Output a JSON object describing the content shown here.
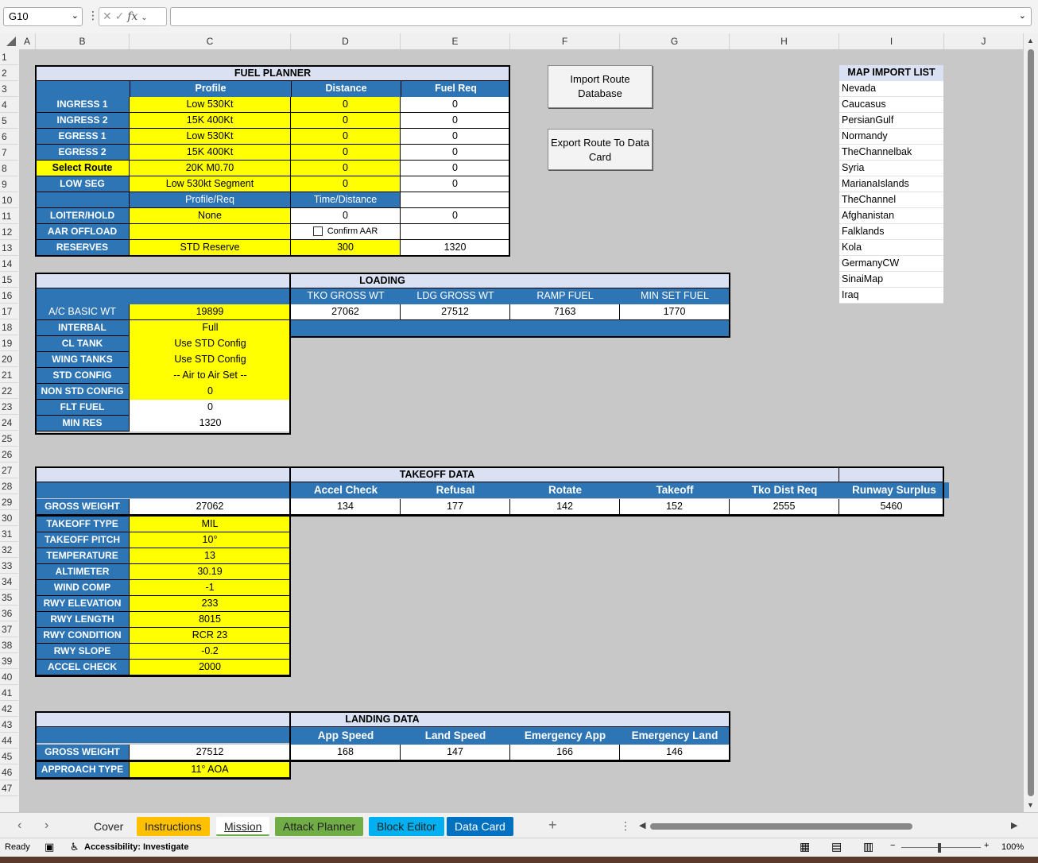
{
  "app": {
    "name_box": "G10",
    "fx_label": "fx",
    "status_ready": "Ready",
    "accessibility": "Accessibility: Investigate",
    "zoom": "100%"
  },
  "columns": [
    "A",
    "B",
    "C",
    "D",
    "E",
    "F",
    "G",
    "H",
    "I",
    "J"
  ],
  "rows": [
    "1",
    "2",
    "3",
    "4",
    "5",
    "6",
    "7",
    "8",
    "9",
    "10",
    "11",
    "12",
    "13",
    "14",
    "15",
    "16",
    "17",
    "18",
    "19",
    "20",
    "21",
    "22",
    "23",
    "24",
    "25",
    "26",
    "27",
    "28",
    "29",
    "30",
    "31",
    "32",
    "33",
    "34",
    "35",
    "36",
    "37",
    "38",
    "39",
    "40",
    "41",
    "42",
    "43",
    "44",
    "45",
    "46",
    "47"
  ],
  "fuel_planner": {
    "title": "FUEL PLANNER",
    "headers": [
      "Profile",
      "Distance",
      "Fuel Req"
    ],
    "rows": [
      {
        "label": "INGRESS 1",
        "profile": "Low 530Kt",
        "distance": "0",
        "fuel": "0"
      },
      {
        "label": "INGRESS 2",
        "profile": "15K 400Kt",
        "distance": "0",
        "fuel": "0"
      },
      {
        "label": "EGRESS 1",
        "profile": "Low 530Kt",
        "distance": "0",
        "fuel": "0"
      },
      {
        "label": "EGRESS 2",
        "profile": "15K 400Kt",
        "distance": "0",
        "fuel": "0"
      },
      {
        "label": "Select Route",
        "profile": "20K M0.70",
        "distance": "0",
        "fuel": "0"
      },
      {
        "label": "LOW SEG",
        "profile": "Low 530kt Segment",
        "distance": "0",
        "fuel": "0"
      }
    ],
    "sub_headers": [
      "Profile/Req",
      "Time/Distance"
    ],
    "loiter": {
      "label": "LOITER/HOLD",
      "profile": "None",
      "time": "0",
      "fuel": "0"
    },
    "aar": {
      "label": "AAR OFFLOAD",
      "confirm": "Confirm AAR"
    },
    "reserves": {
      "label": "RESERVES",
      "profile": "STD Reserve",
      "value": "300",
      "fuel": "1320"
    }
  },
  "buttons": {
    "import": "Import Route Database",
    "export": "Export Route To Data Card"
  },
  "map_import": {
    "title": "MAP IMPORT LIST",
    "items": [
      "Nevada",
      "Caucasus",
      "PersianGulf",
      "Normandy",
      "TheChannelbak",
      "Syria",
      "MarianaIslands",
      "TheChannel",
      "Afghanistan",
      "Falklands",
      "Kola",
      "GermanyCW",
      "SinaiMap",
      "Iraq"
    ]
  },
  "loading": {
    "title": "LOADING",
    "headers": [
      "TKO GROSS WT",
      "LDG GROSS WT",
      "RAMP FUEL",
      "MIN SET FUEL"
    ],
    "basic_label": "A/C BASIC WT",
    "basic_value": "19899",
    "values": [
      "27062",
      "27512",
      "7163",
      "1770"
    ],
    "rows": [
      {
        "label": "INTERBAL",
        "value": "Full",
        "yellow": true
      },
      {
        "label": "CL TANK",
        "value": "Use STD Config",
        "yellow": true
      },
      {
        "label": "WING TANKS",
        "value": "Use STD Config",
        "yellow": true
      },
      {
        "label": "STD CONFIG",
        "value": "-- Air to Air Set --",
        "yellow": true
      },
      {
        "label": "NON STD CONFIG",
        "value": "0",
        "yellow": true
      },
      {
        "label": "FLT FUEL",
        "value": "0",
        "yellow": false
      },
      {
        "label": "MIN RES",
        "value": "1320",
        "yellow": false
      }
    ]
  },
  "takeoff": {
    "title": "TAKEOFF DATA",
    "headers": [
      "Accel Check",
      "Refusal",
      "Rotate",
      "Takeoff",
      "Tko Dist Req",
      "Runway Surplus"
    ],
    "gross_label": "GROSS WEIGHT",
    "gross_value": "27062",
    "values": [
      "134",
      "177",
      "142",
      "152",
      "2555",
      "5460"
    ],
    "rows": [
      {
        "label": "TAKEOFF TYPE",
        "value": "MIL"
      },
      {
        "label": "TAKEOFF PITCH",
        "value": "10°"
      },
      {
        "label": "TEMPERATURE",
        "value": "13"
      },
      {
        "label": "ALTIMETER",
        "value": "30.19"
      },
      {
        "label": "WIND COMP",
        "value": "-1"
      },
      {
        "label": "RWY ELEVATION",
        "value": "233"
      },
      {
        "label": "RWY LENGTH",
        "value": "8015"
      },
      {
        "label": "RWY CONDITION",
        "value": "RCR 23"
      },
      {
        "label": "RWY SLOPE",
        "value": "-0.2"
      },
      {
        "label": "ACCEL CHECK",
        "value": "2000"
      }
    ]
  },
  "landing": {
    "title": "LANDING DATA",
    "headers": [
      "App Speed",
      "Land Speed",
      "Emergency App",
      "Emergency Land"
    ],
    "gross_label": "GROSS WEIGHT",
    "gross_value": "27512",
    "values": [
      "168",
      "147",
      "166",
      "146"
    ],
    "approach_label": "APPROACH TYPE",
    "approach_value": "11° AOA"
  },
  "tabs": [
    {
      "label": "Cover",
      "bg": "#f0f0f0",
      "fg": "#222"
    },
    {
      "label": "Instructions",
      "bg": "#ffc000",
      "fg": "#222"
    },
    {
      "label": "Mission",
      "bg": "#ffffff",
      "fg": "#222"
    },
    {
      "label": "Attack Planner",
      "bg": "#70ad47",
      "fg": "#222"
    },
    {
      "label": "Block Editor",
      "bg": "#00b0f0",
      "fg": "#222"
    },
    {
      "label": "Data Card",
      "bg": "#0070c0",
      "fg": "#ffffff"
    }
  ],
  "colors": {
    "header_blue": "#2e75b6",
    "title_fill": "#d9e1f2",
    "input_yellow": "#ffff00"
  }
}
